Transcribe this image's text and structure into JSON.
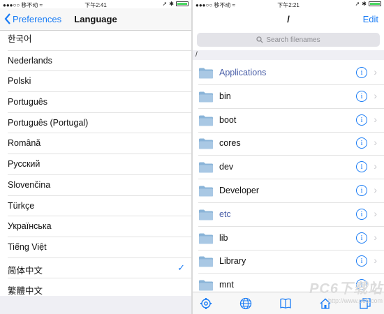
{
  "left_screen": {
    "status": {
      "carrier": "●●●○○ 移不动 ≈",
      "time": "下午2:41"
    },
    "nav": {
      "back_label": "Preferences",
      "title": "Language"
    },
    "languages": [
      {
        "label": "한국어",
        "selected": false
      },
      {
        "label": "Nederlands",
        "selected": false
      },
      {
        "label": "Polski",
        "selected": false
      },
      {
        "label": "Português",
        "selected": false
      },
      {
        "label": "Português (Portugal)",
        "selected": false
      },
      {
        "label": "Română",
        "selected": false
      },
      {
        "label": "Русский",
        "selected": false
      },
      {
        "label": "Slovenčina",
        "selected": false
      },
      {
        "label": "Türkçe",
        "selected": false
      },
      {
        "label": "Українська",
        "selected": false
      },
      {
        "label": "Tiếng Việt",
        "selected": false
      },
      {
        "label": "简体中文",
        "selected": true
      },
      {
        "label": "繁體中文",
        "selected": false
      }
    ],
    "check_glyph": "✓"
  },
  "right_screen": {
    "status": {
      "carrier": "●●●○○ 移不动 ≈",
      "time": "下午2:21"
    },
    "nav": {
      "title": "/",
      "edit_label": "Edit"
    },
    "search": {
      "placeholder": "Search filenames"
    },
    "path": "/",
    "files": [
      {
        "name": "Applications",
        "style": "link"
      },
      {
        "name": "bin",
        "style": "normal"
      },
      {
        "name": "boot",
        "style": "normal"
      },
      {
        "name": "cores",
        "style": "normal"
      },
      {
        "name": "dev",
        "style": "normal"
      },
      {
        "name": "Developer",
        "style": "normal"
      },
      {
        "name": "etc",
        "style": "link"
      },
      {
        "name": "lib",
        "style": "normal"
      },
      {
        "name": "Library",
        "style": "normal"
      },
      {
        "name": "mnt",
        "style": "normal"
      }
    ],
    "info_glyph": "i",
    "chevron_glyph": "›",
    "tabs": [
      "gear-icon",
      "globe-icon",
      "bookmarks-icon",
      "home-icon",
      "copy-icon"
    ]
  },
  "watermark": {
    "brand": "PC6下载站",
    "url": "http://www.pc6.com"
  },
  "colors": {
    "accent": "#1a7cf5",
    "folder": "#8ab4d8",
    "battery": "#4cd964"
  }
}
